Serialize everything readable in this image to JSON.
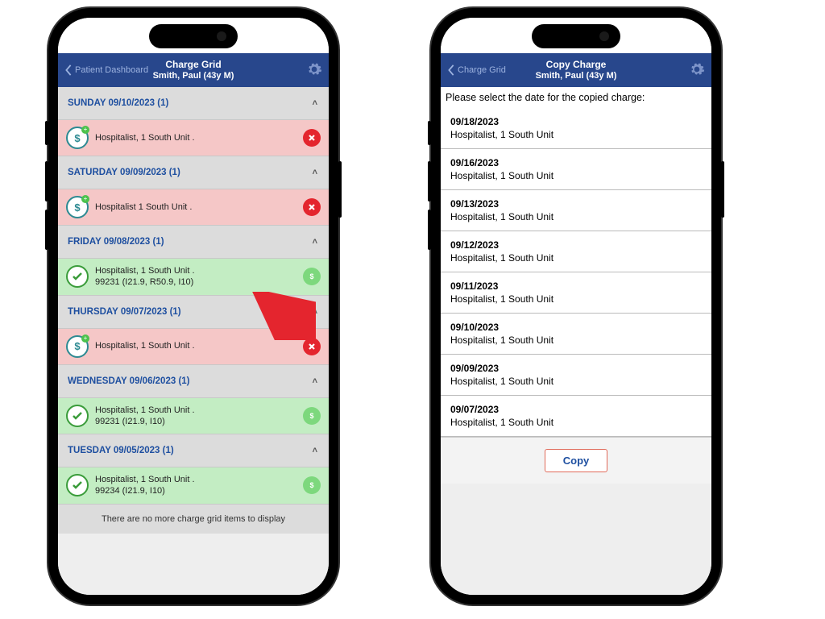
{
  "left": {
    "back_label": "Patient Dashboard",
    "title": "Charge Grid",
    "subtitle": "Smith, Paul (43y M)",
    "no_more": "There are no more charge grid items to display",
    "days": [
      {
        "header": "SUNDAY 09/10/2023 (1)",
        "rows": [
          {
            "line1": "Hospitalist,   1 South Unit .",
            "line2": "",
            "status": "red"
          }
        ]
      },
      {
        "header": "SATURDAY 09/09/2023 (1)",
        "rows": [
          {
            "line1": "Hospitalist   1 South Unit .",
            "line2": "",
            "status": "red"
          }
        ]
      },
      {
        "header": "FRIDAY 09/08/2023 (1)",
        "rows": [
          {
            "line1": "Hospitalist, 1 South Unit .",
            "line2": "99231 (I21.9, R50.9, I10)",
            "status": "green"
          }
        ]
      },
      {
        "header": "THURSDAY 09/07/2023 (1)",
        "rows": [
          {
            "line1": "Hospitalist,   1 South Unit .",
            "line2": "",
            "status": "red"
          }
        ]
      },
      {
        "header": "WEDNESDAY 09/06/2023 (1)",
        "rows": [
          {
            "line1": "Hospitalist, 1 South Unit .",
            "line2": "99231 (I21.9, I10)",
            "status": "green"
          }
        ]
      },
      {
        "header": "TUESDAY 09/05/2023 (1)",
        "rows": [
          {
            "line1": "Hospitalist, 1 South Unit .",
            "line2": "99234 (I21.9, I10)",
            "status": "green"
          }
        ]
      }
    ]
  },
  "right": {
    "back_label": "Charge Grid",
    "title": "Copy Charge",
    "subtitle": "Smith, Paul (43y M)",
    "instruction": "Please select the date for the copied charge:",
    "copy_label": "Copy",
    "options": [
      {
        "date": "09/18/2023",
        "meta": "Hospitalist,   1 South Unit"
      },
      {
        "date": "09/16/2023",
        "meta": "Hospitalist,   1 South Unit"
      },
      {
        "date": "09/13/2023",
        "meta": "Hospitalist,   1 South Unit"
      },
      {
        "date": "09/12/2023",
        "meta": "Hospitalist,   1 South Unit"
      },
      {
        "date": "09/11/2023",
        "meta": "Hospitalist,   1 South Unit"
      },
      {
        "date": "09/10/2023",
        "meta": "Hospitalist,   1 South Unit"
      },
      {
        "date": "09/09/2023",
        "meta": "Hospitalist,   1 South Unit"
      },
      {
        "date": "09/07/2023",
        "meta": "Hospitalist,   1 South Unit"
      }
    ]
  }
}
